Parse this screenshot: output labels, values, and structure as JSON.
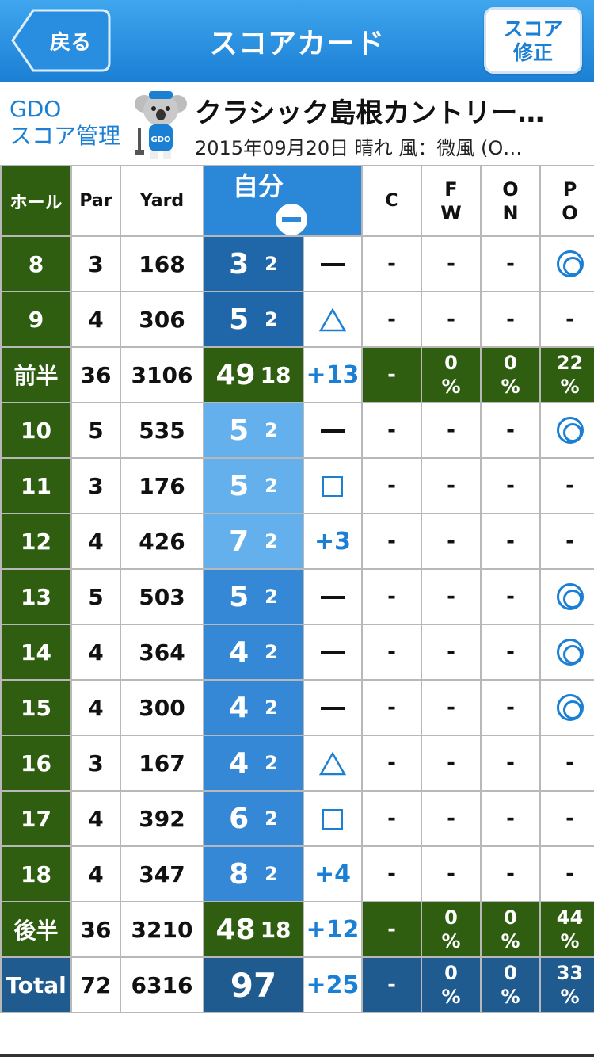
{
  "nav": {
    "title": "スコアカード",
    "back_label": "戻る",
    "fix_label_line1": "スコア",
    "fix_label_line2": "修正"
  },
  "header": {
    "brand_line1": "GDO",
    "brand_line2": "スコア管理",
    "course_name": "クラシック島根カントリー…",
    "meta": "2015年09月20日  晴れ  風：微風  (O…",
    "mascot_badge": "GDO"
  },
  "table": {
    "headers": {
      "hole": "ホール",
      "par": "Par",
      "yard": "Yard",
      "mine": "自分",
      "c": "C",
      "fw1": "F",
      "fw2": "W",
      "on1": "O",
      "on2": "N",
      "po1": "P",
      "po2": "O"
    },
    "rows": [
      {
        "hole": "8",
        "par": "3",
        "yard": "168",
        "score": "3",
        "putt": "2",
        "mark": "dash",
        "c": "-",
        "fw": "-",
        "on": "-",
        "po": "dblcircle",
        "shade": "dark"
      },
      {
        "hole": "9",
        "par": "4",
        "yard": "306",
        "score": "5",
        "putt": "2",
        "mark": "triangle",
        "c": "-",
        "fw": "-",
        "on": "-",
        "po": "-",
        "shade": "dark"
      },
      {
        "type": "sum",
        "label": "前半",
        "par": "36",
        "yard": "3106",
        "score": "49",
        "putt": "18",
        "mark": "+13",
        "c": "-",
        "fw_pct": "0",
        "on_pct": "0",
        "po_pct": "22",
        "pct_sign": "%"
      },
      {
        "hole": "10",
        "par": "5",
        "yard": "535",
        "score": "5",
        "putt": "2",
        "mark": "dash",
        "c": "-",
        "fw": "-",
        "on": "-",
        "po": "dblcircle",
        "shade": "light"
      },
      {
        "hole": "11",
        "par": "3",
        "yard": "176",
        "score": "5",
        "putt": "2",
        "mark": "square",
        "c": "-",
        "fw": "-",
        "on": "-",
        "po": "-",
        "shade": "light"
      },
      {
        "hole": "12",
        "par": "4",
        "yard": "426",
        "score": "7",
        "putt": "2",
        "mark": "+3",
        "c": "-",
        "fw": "-",
        "on": "-",
        "po": "-",
        "shade": "light"
      },
      {
        "hole": "13",
        "par": "5",
        "yard": "503",
        "score": "5",
        "putt": "2",
        "mark": "dash",
        "c": "-",
        "fw": "-",
        "on": "-",
        "po": "dblcircle",
        "shade": "mid"
      },
      {
        "hole": "14",
        "par": "4",
        "yard": "364",
        "score": "4",
        "putt": "2",
        "mark": "dash",
        "c": "-",
        "fw": "-",
        "on": "-",
        "po": "dblcircle",
        "shade": "mid"
      },
      {
        "hole": "15",
        "par": "4",
        "yard": "300",
        "score": "4",
        "putt": "2",
        "mark": "dash",
        "c": "-",
        "fw": "-",
        "on": "-",
        "po": "dblcircle",
        "shade": "mid"
      },
      {
        "hole": "16",
        "par": "3",
        "yard": "167",
        "score": "4",
        "putt": "2",
        "mark": "triangle",
        "c": "-",
        "fw": "-",
        "on": "-",
        "po": "-",
        "shade": "mid"
      },
      {
        "hole": "17",
        "par": "4",
        "yard": "392",
        "score": "6",
        "putt": "2",
        "mark": "square",
        "c": "-",
        "fw": "-",
        "on": "-",
        "po": "-",
        "shade": "mid"
      },
      {
        "hole": "18",
        "par": "4",
        "yard": "347",
        "score": "8",
        "putt": "2",
        "mark": "+4",
        "c": "-",
        "fw": "-",
        "on": "-",
        "po": "-",
        "shade": "mid"
      },
      {
        "type": "sum",
        "label": "後半",
        "par": "36",
        "yard": "3210",
        "score": "48",
        "putt": "18",
        "mark": "+12",
        "c": "-",
        "fw_pct": "0",
        "on_pct": "0",
        "po_pct": "44",
        "pct_sign": "%"
      },
      {
        "type": "total",
        "label": "Total",
        "par": "72",
        "yard": "6316",
        "score": "97",
        "mark": "+25",
        "c": "-",
        "fw_pct": "0",
        "on_pct": "0",
        "po_pct": "33",
        "pct_sign": "%"
      }
    ]
  },
  "colors": {
    "nav_blue": "#1b7fd4",
    "green": "#2f5e10",
    "score_dark": "#1f67a8",
    "score_mid": "#3588d6",
    "score_light": "#64b0ec",
    "total_blue": "#1f5b8e"
  }
}
